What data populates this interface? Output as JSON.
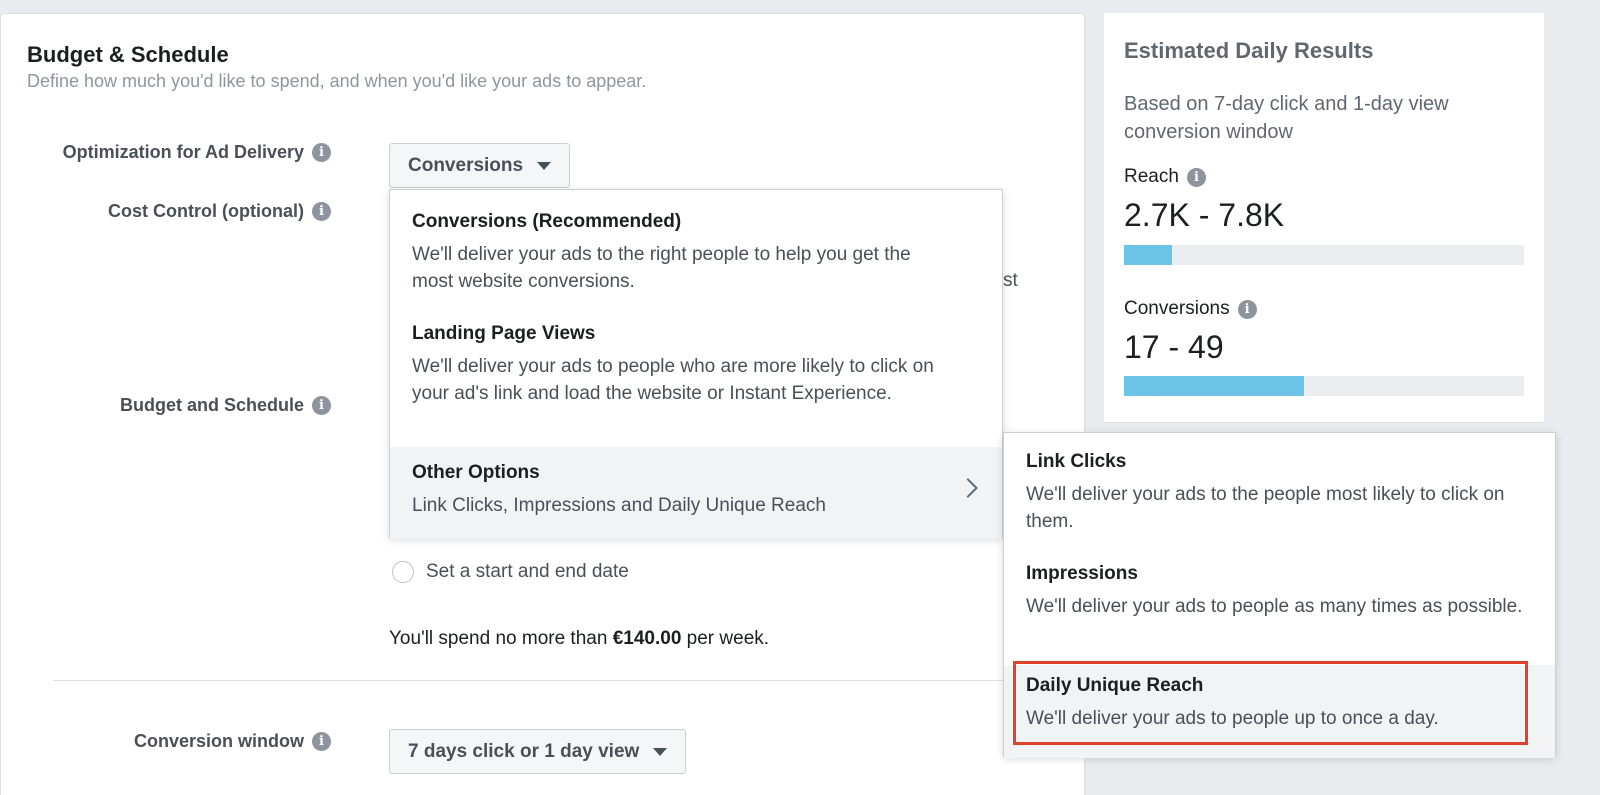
{
  "section": {
    "title": "Budget & Schedule",
    "subtitle": "Define how much you'd like to spend, and when you'd like your ads to appear."
  },
  "fields": {
    "optimization_label": "Optimization for Ad Delivery",
    "cost_control_label": "Cost Control (optional)",
    "budget_schedule_label": "Budget and Schedule",
    "conversion_window_label": "Conversion window"
  },
  "optimization_dropdown": {
    "value": "Conversions"
  },
  "conversion_window_dropdown": {
    "value": "7 days click or 1 day view"
  },
  "clipped_text": "st",
  "schedule": {
    "radio_label": "Set a start and end date"
  },
  "spend": {
    "prefix": "You'll spend no more than ",
    "amount": "€140.00",
    "suffix": " per week."
  },
  "menu": {
    "items": [
      {
        "title": "Conversions (Recommended)",
        "desc": "We'll deliver your ads to the right people to help you get the most website conversions."
      },
      {
        "title": "Landing Page Views",
        "desc": "We'll deliver your ads to people who are more likely to click on your ad's link and load the website or Instant Experience."
      },
      {
        "title": "Other Options",
        "desc": "Link Clicks, Impressions and Daily Unique Reach"
      }
    ]
  },
  "submenu": {
    "items": [
      {
        "title": "Link Clicks",
        "desc": "We'll deliver your ads to the people most likely to click on them."
      },
      {
        "title": "Impressions",
        "desc": "We'll deliver your ads to people as many times as possible."
      },
      {
        "title": "Daily Unique Reach",
        "desc": "We'll deliver your ads to people up to once a day."
      }
    ]
  },
  "results": {
    "title": "Estimated Daily Results",
    "basis": "Based on 7-day click and 1-day view conversion window",
    "reach": {
      "label": "Reach",
      "value": "2.7K - 7.8K",
      "bar_fraction": 0.12
    },
    "conversions": {
      "label": "Conversions",
      "value": "17 - 49",
      "bar_fraction": 0.45
    }
  },
  "colors": {
    "bar": "#6bc3e6",
    "highlight": "#e0412b"
  },
  "icons": {
    "info": "info-icon",
    "caret": "caret-down-icon",
    "chevron": "chevron-right-icon"
  }
}
